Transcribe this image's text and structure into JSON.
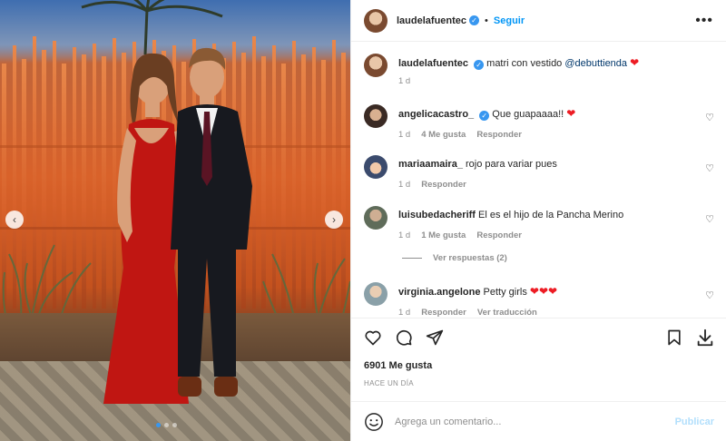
{
  "post": {
    "author": "laudelafuentec",
    "follow_label": "Seguir",
    "separator": "•",
    "more_icon": "more-options-icon"
  },
  "caption": {
    "author": "laudelafuentec",
    "text": "matri con vestido",
    "mention": "@debuttienda",
    "time": "1 d"
  },
  "comments": [
    {
      "author": "angelicacastro_",
      "verified": true,
      "text": "Que guapaaaa!!",
      "time": "1 d",
      "likes": "4 Me gusta",
      "reply": "Responder"
    },
    {
      "author": "mariaamaira_",
      "verified": false,
      "text": "rojo para variar pues",
      "time": "1 d",
      "reply": "Responder"
    },
    {
      "author": "luisubedacheriff",
      "verified": false,
      "text": "El es el hijo de la Pancha Merino",
      "time": "1 d",
      "likes": "1 Me gusta",
      "reply": "Responder"
    },
    {
      "author": "virginia.angelone",
      "verified": false,
      "text": "Petty girls",
      "time": "1 d",
      "reply": "Responder",
      "translate": "Ver traducción"
    }
  ],
  "view_replies": "Ver respuestas (2)",
  "stats": {
    "likes": "6901 Me gusta",
    "ago": "HACE UN DÍA"
  },
  "composer": {
    "placeholder": "Agrega un comentario...",
    "publish": "Publicar"
  },
  "colors": {
    "accent": "#0095f6",
    "heart": "#ed1c24",
    "muted": "#8e8e8e"
  }
}
